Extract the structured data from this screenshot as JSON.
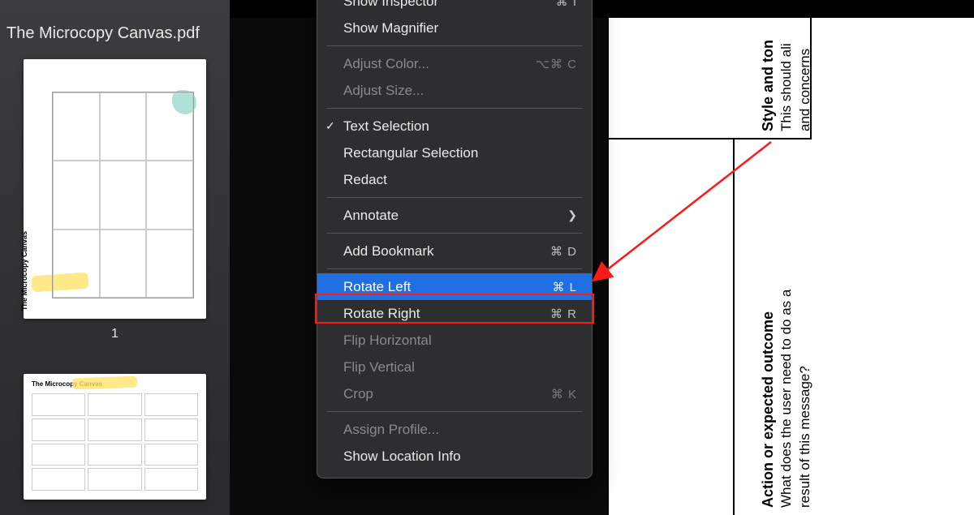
{
  "sidebar": {
    "title": "The Microcopy Canvas.pdf",
    "page_number": "1",
    "thumb1_title": "The Microcopy Canvas",
    "thumb2_title": "The Microcopy Canvas"
  },
  "menu": {
    "show_inspector": {
      "label": "Show Inspector",
      "shortcut": "⌘ I"
    },
    "show_magnifier": {
      "label": "Show Magnifier",
      "shortcut": ""
    },
    "adjust_color": {
      "label": "Adjust Color...",
      "shortcut": "⌥⌘ C"
    },
    "adjust_size": {
      "label": "Adjust Size...",
      "shortcut": ""
    },
    "text_selection": {
      "label": "Text Selection",
      "shortcut": ""
    },
    "rect_selection": {
      "label": "Rectangular Selection",
      "shortcut": ""
    },
    "redact": {
      "label": "Redact",
      "shortcut": ""
    },
    "annotate": {
      "label": "Annotate",
      "shortcut": ""
    },
    "add_bookmark": {
      "label": "Add Bookmark",
      "shortcut": "⌘ D"
    },
    "rotate_left": {
      "label": "Rotate Left",
      "shortcut": "⌘ L"
    },
    "rotate_right": {
      "label": "Rotate Right",
      "shortcut": "⌘ R"
    },
    "flip_horizontal": {
      "label": "Flip Horizontal",
      "shortcut": ""
    },
    "flip_vertical": {
      "label": "Flip Vertical",
      "shortcut": ""
    },
    "crop": {
      "label": "Crop",
      "shortcut": "⌘ K"
    },
    "assign_profile": {
      "label": "Assign Profile...",
      "shortcut": ""
    },
    "show_location": {
      "label": "Show Location Info",
      "shortcut": ""
    }
  },
  "document": {
    "style_heading": "Style and ton",
    "style_line1": "This should ali",
    "style_line2": "and concerns",
    "action_heading": "Action or expected outcome",
    "action_line1": "What does the user need to do as a",
    "action_line2": "result of this message?"
  }
}
